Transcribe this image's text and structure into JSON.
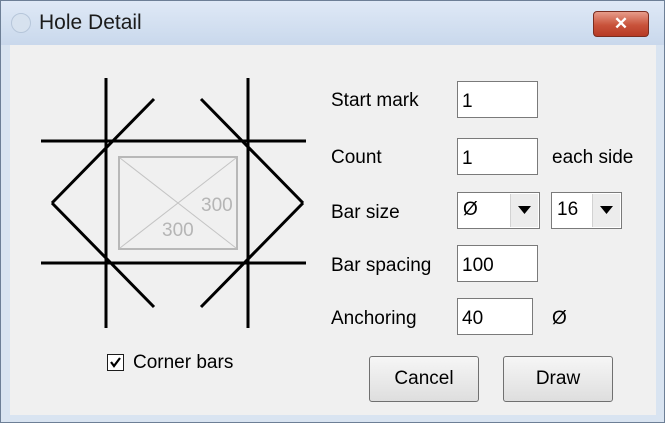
{
  "window": {
    "title": "Hole Detail",
    "close_icon": "close-x-icon"
  },
  "diagram": {
    "dim_vertical": "300",
    "dim_horizontal": "300"
  },
  "corner_bars": {
    "label": "Corner bars",
    "checked": true
  },
  "form": {
    "start_mark": {
      "label": "Start mark",
      "value": "1"
    },
    "count": {
      "label": "Count",
      "value": "1",
      "suffix": "each side"
    },
    "bar_size": {
      "label": "Bar size",
      "type_value": "Ø",
      "size_value": "16"
    },
    "bar_spacing": {
      "label": "Bar spacing",
      "value": "100"
    },
    "anchoring": {
      "label": "Anchoring",
      "value": "40",
      "suffix": "Ø"
    }
  },
  "buttons": {
    "cancel": "Cancel",
    "draw": "Draw"
  }
}
